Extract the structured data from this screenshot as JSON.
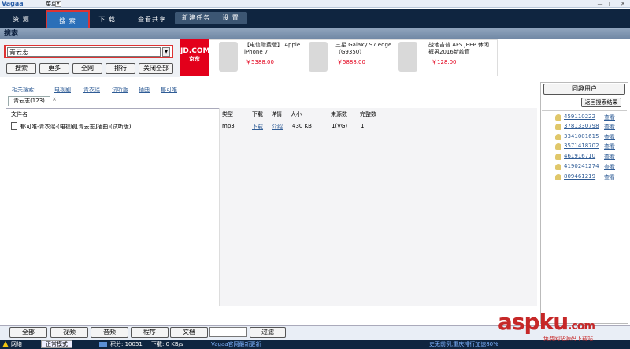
{
  "app": {
    "logo": "Vagaa",
    "menu_label": "菜单",
    "window_controls": [
      "minimize",
      "maximize",
      "close"
    ]
  },
  "nav": {
    "tabs": [
      {
        "label": "资 源"
      },
      {
        "label": "搜 索"
      },
      {
        "label": "下 载"
      },
      {
        "label": "查看共享"
      },
      {
        "label": "新建任务"
      },
      {
        "label": "设 置"
      }
    ]
  },
  "section_title": "搜索",
  "search": {
    "value": "青云志",
    "buttons": [
      "搜索",
      "更多",
      "全网",
      "排行",
      "关闭全部"
    ]
  },
  "ads": {
    "jd_logo": "JD.COM",
    "jd_sub": "京东",
    "items": [
      {
        "title": "【电信赠费版】 Apple iPhone 7",
        "price": "￥5388.00"
      },
      {
        "title": "三星 Galaxy S7 edge（G9350）",
        "price": "￥5888.00"
      },
      {
        "title": "战地吉普 AFS JEEP 休闲裤男2016新款直",
        "price": "￥128.00"
      }
    ]
  },
  "related": {
    "label": "相关搜索:",
    "links": [
      "电视剧",
      "青衣谣",
      "试听版",
      "插曲",
      "郁可唯"
    ]
  },
  "results_tab": {
    "label": "青云志(123)",
    "close": "×"
  },
  "table": {
    "headers": [
      "文件名",
      "类型",
      "下载",
      "详情",
      "大小",
      "来源数",
      "完整数"
    ],
    "rows": [
      {
        "name": "郁可唯-青衣谣-(电视剧[青云志]插曲)(试听版)",
        "type": "mp3",
        "download": "下载",
        "detail": "介绍",
        "size": "430 KB",
        "sources": "1(VG)",
        "complete": "1"
      }
    ]
  },
  "right_panel": {
    "online_users": "同趣用户",
    "back_button": "返回搜索结果",
    "users": [
      {
        "id": "459110222",
        "view": "查看"
      },
      {
        "id": "3781330798",
        "view": "查看"
      },
      {
        "id": "3341001615",
        "view": "查看"
      },
      {
        "id": "3571418702",
        "view": "查看"
      },
      {
        "id": "461916710",
        "view": "查看"
      },
      {
        "id": "4190241274",
        "view": "查看"
      },
      {
        "id": "809461219",
        "view": "查看"
      }
    ]
  },
  "filters": {
    "buttons": [
      "全部",
      "视频",
      "音频",
      "程序",
      "文档"
    ],
    "filter_button": "过滤"
  },
  "status": {
    "network": "网络",
    "mode": "正常模式",
    "points": "积分: 10051",
    "download_speed": "下载: 0 KB/s",
    "announcement": "Vagaa官网最新更新",
    "promo": "史无前例,重庆排行加速80%"
  },
  "watermark": {
    "text": "aspku",
    "suffix": ".com",
    "sub": "免费网站源码下载站"
  }
}
